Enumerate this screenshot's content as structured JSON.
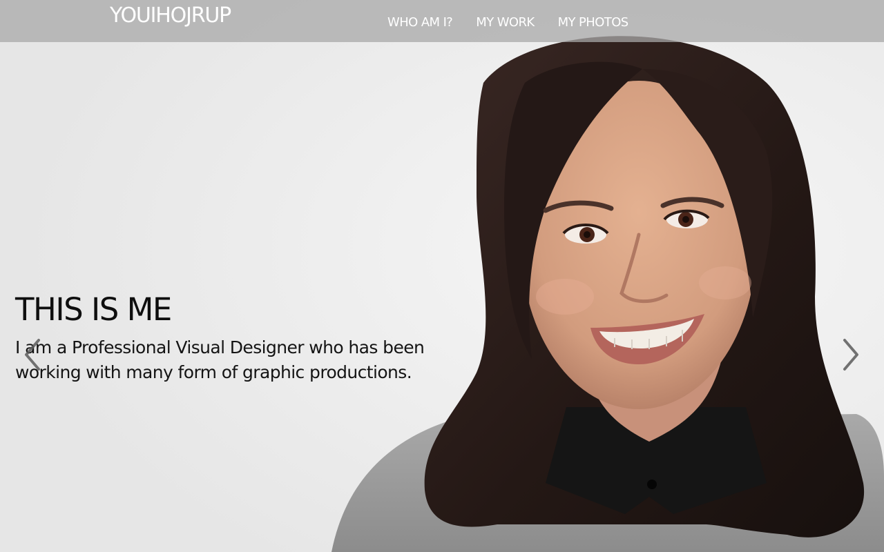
{
  "header": {
    "brand": "YOUIHOJRUP",
    "nav_items": [
      {
        "label": "WHO AM I?"
      },
      {
        "label": "MY WORK"
      },
      {
        "label": "MY PHOTOS"
      }
    ]
  },
  "hero": {
    "title": "THIS IS ME",
    "text": "I am a Professional Visual Designer who has been working with many form of graphic productions.",
    "image_description_icon": "portrait-photo",
    "prev_icon": "chevron-left-icon",
    "next_icon": "chevron-right-icon"
  },
  "colors": {
    "navbar_bg": "#a8a8a8",
    "nav_text": "#ffffff",
    "hero_bg": "#efefef",
    "caption_text": "#111111",
    "hair": "#2b1d1a",
    "skin": "#d9a587",
    "sweater": "#9b9b9b",
    "collar": "#1a1a1a"
  }
}
